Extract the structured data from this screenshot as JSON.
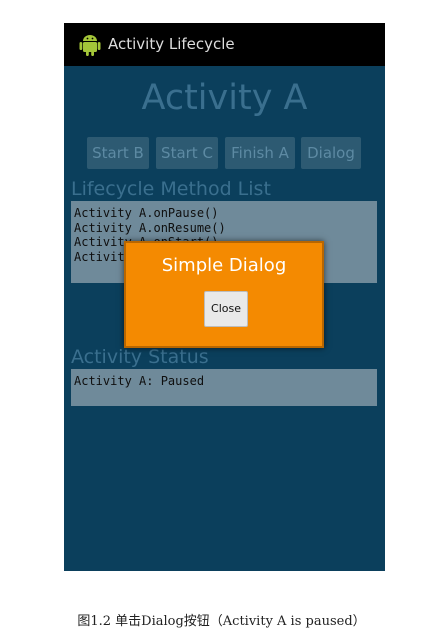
{
  "titlebar": {
    "title": "Activity Lifecycle",
    "icon": "android-robot-icon"
  },
  "main": {
    "activity_title": "Activity A",
    "buttons": [
      {
        "label": "Start B"
      },
      {
        "label": "Start C"
      },
      {
        "label": "Finish A"
      },
      {
        "label": "Dialog"
      }
    ],
    "lifecycle_heading": "Lifecycle Method List",
    "lifecycle_lines": [
      "Activity A.onPause()",
      "Activity A.onResume()",
      "Activity A.onStart()",
      "Activity A.onCreate()"
    ],
    "status_heading": "Activity Status",
    "status_lines": [
      "Activity A: Paused"
    ]
  },
  "dialog": {
    "title": "Simple Dialog",
    "close_label": "Close"
  },
  "caption": "图1.2 单击Dialog按钮（Activity A is paused）",
  "colors": {
    "screen_bg": "#0b3f5c",
    "dialog_bg": "#f48a01",
    "titlebar_bg": "#000000",
    "android_green": "#a4c639"
  }
}
